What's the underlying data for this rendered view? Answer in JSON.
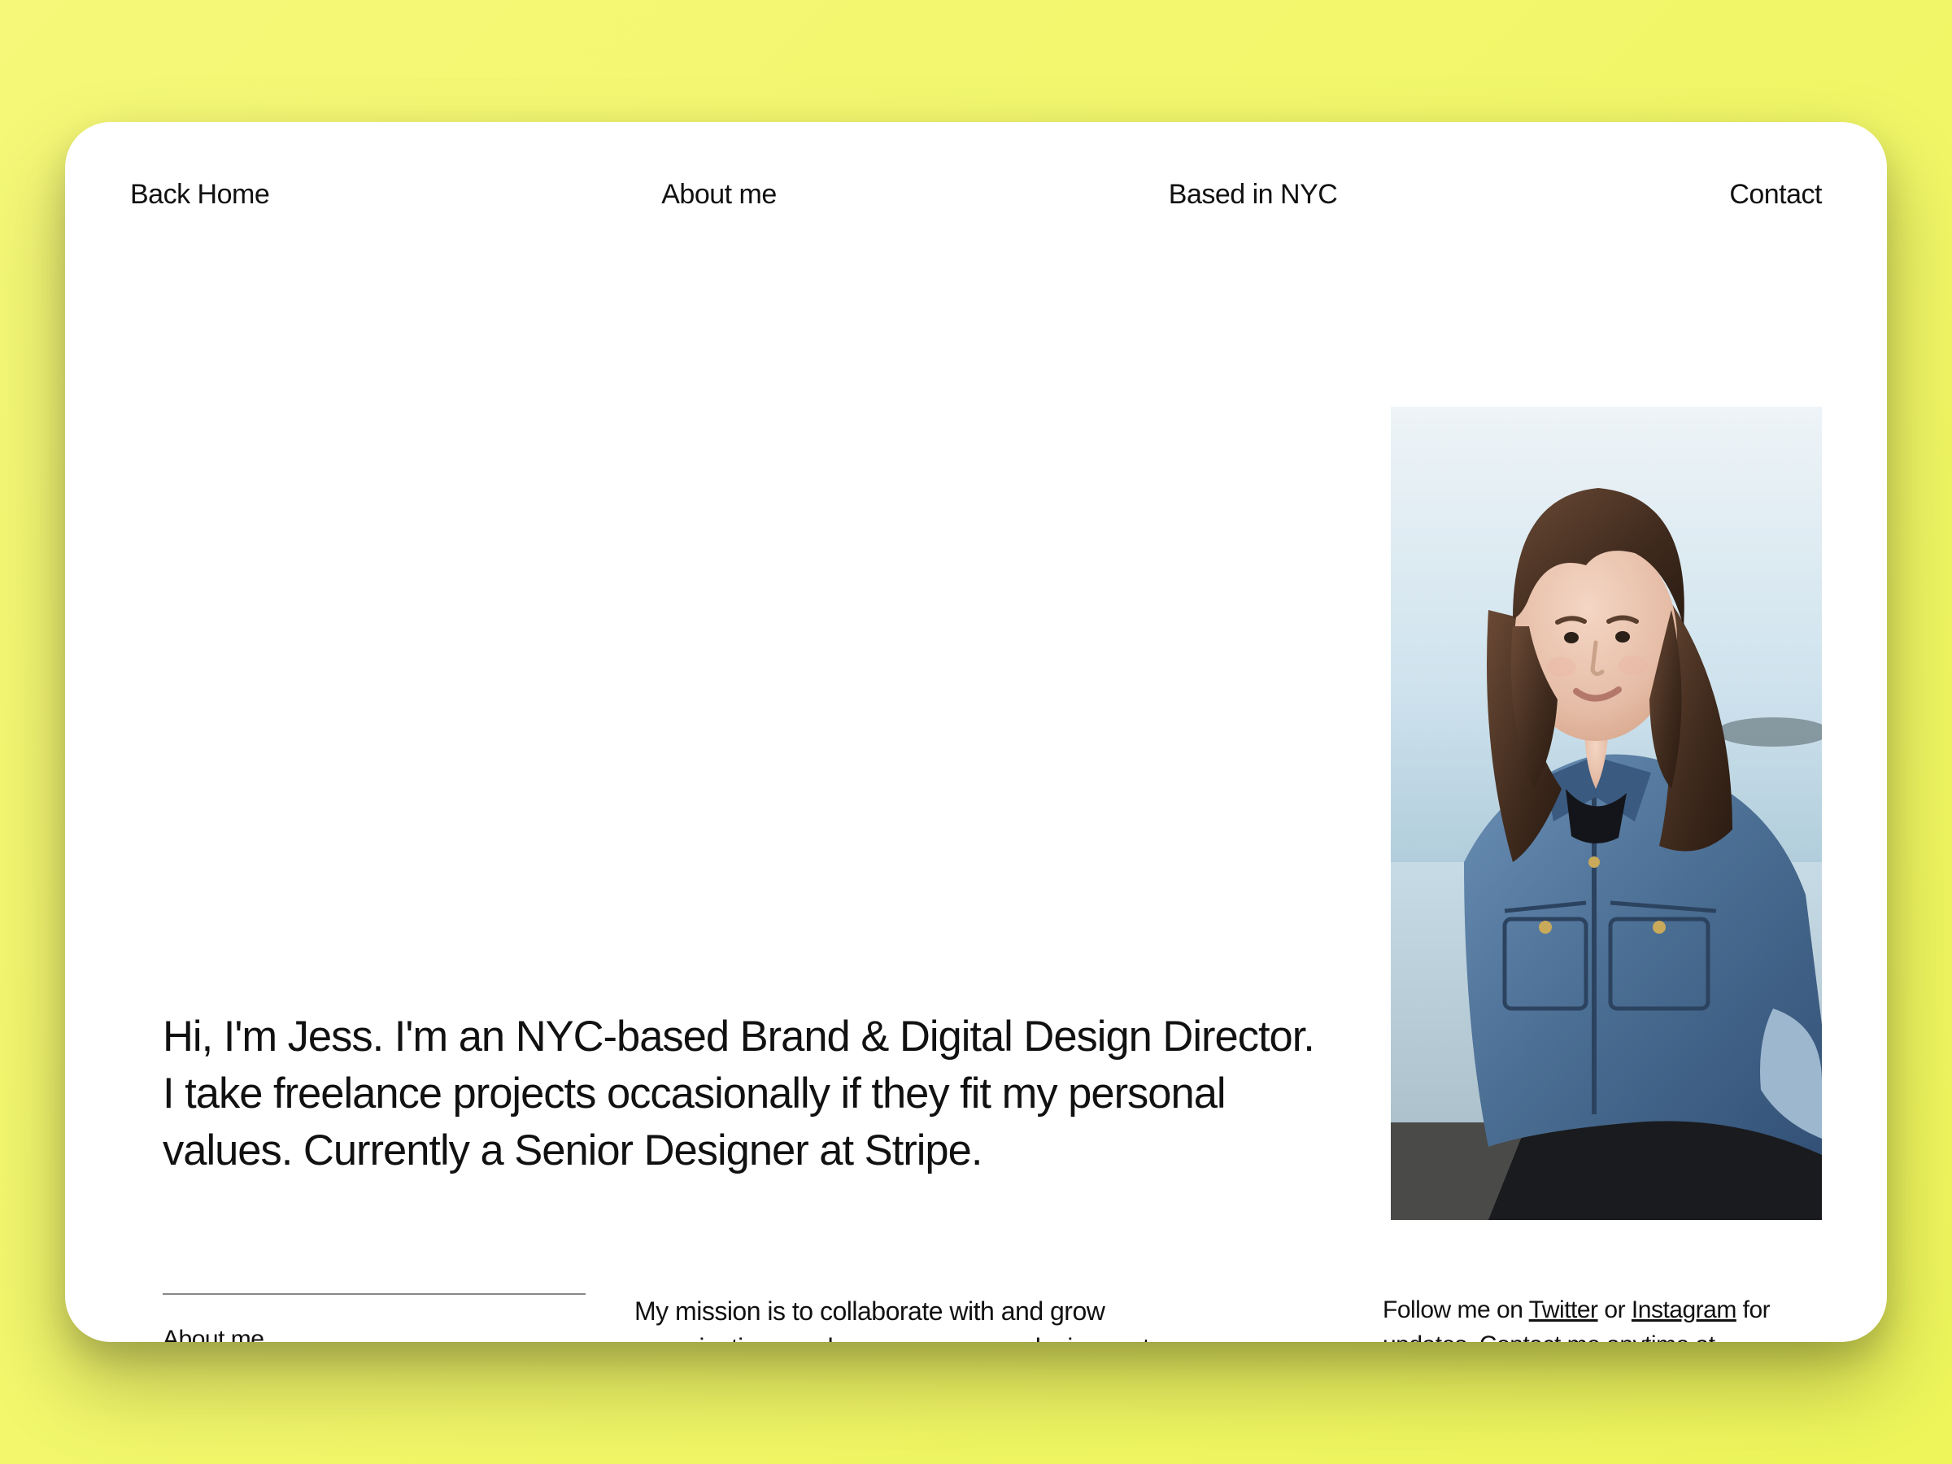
{
  "nav": {
    "back_home": "Back Home",
    "about_me": "About me",
    "location": "Based in NYC",
    "contact": "Contact"
  },
  "hero": {
    "intro": "Hi, I'm Jess. I'm an NYC-based Brand & Digital Design Director. I take freelance projects occasionally if they fit my personal values. Currently a Senior Designer at Stripe."
  },
  "about": {
    "label": "About me",
    "mission": "My mission is to collaborate with and grow organizations and empower young designers to see"
  },
  "follow": {
    "prefix": "Follow me on ",
    "twitter": "Twitter",
    "or": " or ",
    "instagram": "Instagram",
    "suffix": " for updates. Contact me anytime at"
  },
  "photo": {
    "alt": "Portrait photo of Jess wearing a denim jacket by the water"
  }
}
